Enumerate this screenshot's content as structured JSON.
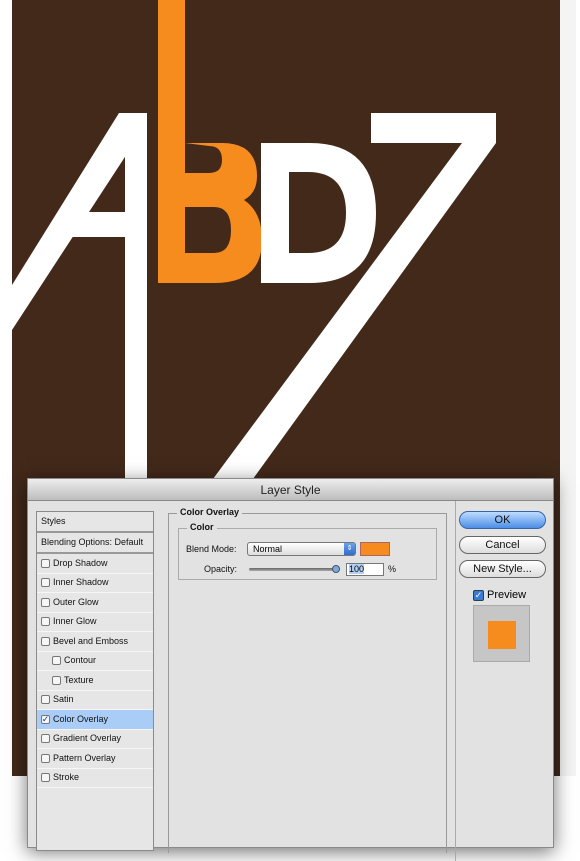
{
  "artwork": {
    "background": "#42291a",
    "letters_color": "#ffffff",
    "accent": "#f68c1e",
    "letters": "ABD7"
  },
  "dialog": {
    "title": "Layer Style",
    "styles_list": [
      {
        "label": "Styles",
        "type": "header"
      },
      {
        "label": "Blending Options: Default",
        "type": "header"
      },
      {
        "label": "Drop Shadow",
        "checked": false
      },
      {
        "label": "Inner Shadow",
        "checked": false
      },
      {
        "label": "Outer Glow",
        "checked": false
      },
      {
        "label": "Inner Glow",
        "checked": false
      },
      {
        "label": "Bevel and Emboss",
        "checked": false
      },
      {
        "label": "Contour",
        "checked": false,
        "indent": true
      },
      {
        "label": "Texture",
        "checked": false,
        "indent": true
      },
      {
        "label": "Satin",
        "checked": false
      },
      {
        "label": "Color Overlay",
        "checked": true,
        "selected": true
      },
      {
        "label": "Gradient Overlay",
        "checked": false
      },
      {
        "label": "Pattern Overlay",
        "checked": false
      },
      {
        "label": "Stroke",
        "checked": false
      }
    ],
    "panel": {
      "title": "Color Overlay",
      "group": "Color",
      "blend_mode_label": "Blend Mode:",
      "blend_mode": "Normal",
      "overlay_color": "#f68c1e",
      "opacity_label": "Opacity:",
      "opacity": "100",
      "opacity_unit": "%"
    },
    "buttons": {
      "ok": "OK",
      "cancel": "Cancel",
      "new_style": "New Style..."
    },
    "preview": {
      "label": "Preview",
      "checked": true
    }
  }
}
